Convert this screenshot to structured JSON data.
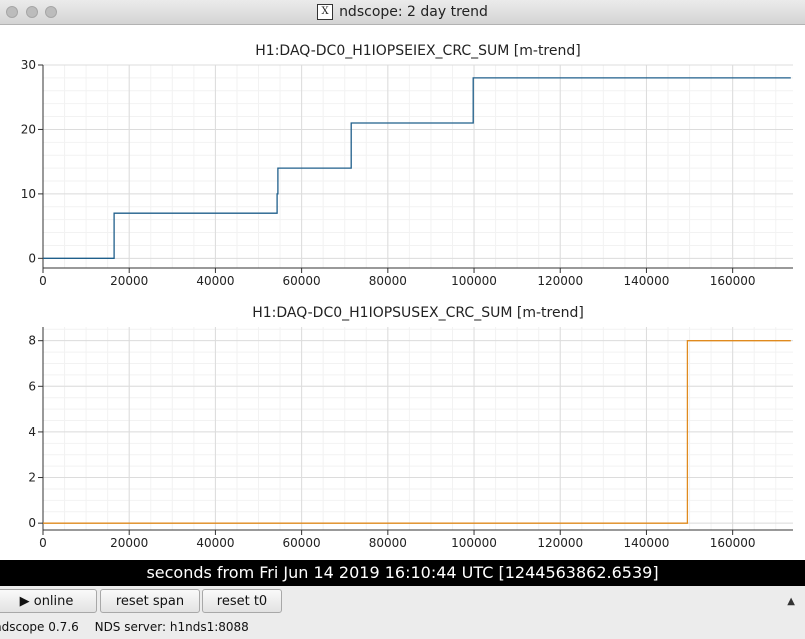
{
  "window": {
    "title": "ndscope: 2 day trend"
  },
  "plots": [
    {
      "title": "H1:DAQ-DC0_H1IOPSEIEX_CRC_SUM [m-trend]",
      "color": "#1f5f8b",
      "y_ticks": [
        "30",
        "20",
        "10",
        "0"
      ],
      "x_ticks": [
        "0",
        "20000",
        "40000",
        "60000",
        "80000",
        "100000",
        "120000",
        "140000",
        "160000"
      ]
    },
    {
      "title": "H1:DAQ-DC0_H1IOPSUSEX_CRC_SUM [m-trend]",
      "color": "#e08a1e",
      "y_ticks": [
        "8",
        "6",
        "4",
        "2",
        "0"
      ],
      "x_ticks": [
        "0",
        "20000",
        "40000",
        "60000",
        "80000",
        "100000",
        "120000",
        "140000",
        "160000"
      ]
    }
  ],
  "chart_data": [
    {
      "type": "line",
      "title": "H1:DAQ-DC0_H1IOPSEIEX_CRC_SUM [m-trend]",
      "xlim": [
        0,
        174000
      ],
      "ylim": [
        -1.5,
        30
      ],
      "grid": true,
      "series": [
        {
          "x": [
            0,
            16500,
            16500,
            54300,
            54300,
            54500,
            54500,
            71500,
            71500,
            99800,
            99800,
            173500
          ],
          "y": [
            0,
            0,
            7,
            7,
            10,
            10,
            14,
            14,
            21,
            21,
            28,
            28
          ]
        }
      ]
    },
    {
      "type": "line",
      "title": "H1:DAQ-DC0_H1IOPSUSEX_CRC_SUM [m-trend]",
      "xlim": [
        0,
        174000
      ],
      "ylim": [
        -0.3,
        8.6
      ],
      "grid": true,
      "series": [
        {
          "x": [
            0,
            149500,
            149500,
            173500
          ],
          "y": [
            0,
            0,
            8,
            8
          ]
        }
      ]
    }
  ],
  "timebar": {
    "text": "seconds from Fri Jun 14 2019 16:10:44 UTC [1244563862.6539]"
  },
  "buttons": {
    "online": "online",
    "online_icon": "▶",
    "reset_span": "reset span",
    "reset_t0": "reset t0",
    "collapse_icon": "▲"
  },
  "status": {
    "version": "ndscope 0.7.6",
    "server": "NDS server: h1nds1:8088"
  }
}
